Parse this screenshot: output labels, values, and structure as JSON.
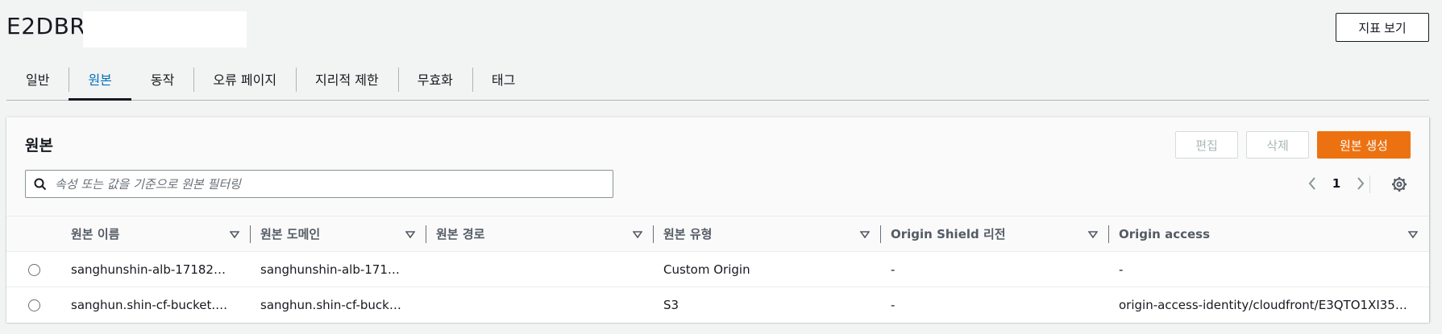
{
  "header": {
    "title": "E2DBR",
    "metrics_button": "지표 보기"
  },
  "tabs": [
    {
      "label": "일반",
      "active": false
    },
    {
      "label": "원본",
      "active": true
    },
    {
      "label": "동작",
      "active": false
    },
    {
      "label": "오류 페이지",
      "active": false
    },
    {
      "label": "지리적 제한",
      "active": false
    },
    {
      "label": "무효화",
      "active": false
    },
    {
      "label": "태그",
      "active": false
    }
  ],
  "panel": {
    "title": "원본",
    "edit_button": "편집",
    "delete_button": "삭제",
    "create_button": "원본 생성",
    "search_placeholder": "속성 또는 값을 기준으로 원본 필터링",
    "page_number": "1"
  },
  "table": {
    "columns": [
      "원본 이름",
      "원본 도메인",
      "원본 경로",
      "원본 유형",
      "Origin Shield 리전",
      "Origin access"
    ],
    "rows": [
      {
        "name": "sanghunshin-alb-17182…",
        "domain": "sanghunshin-alb-171…",
        "path": "",
        "type": "Custom Origin",
        "shield": "-",
        "access": "-"
      },
      {
        "name": "sanghun.shin-cf-bucket.…",
        "domain": "sanghun.shin-cf-buck…",
        "path": "",
        "type": "S3",
        "shield": "-",
        "access": "origin-access-identity/cloudfront/E3QTO1XI35…"
      }
    ]
  },
  "colors": {
    "primary_button": "#ec7211",
    "active_tab_text": "#0073bb",
    "border": "#aab7b8"
  },
  "icons": [
    "search-icon",
    "chevron-left-icon",
    "chevron-right-icon",
    "settings-gear-icon",
    "sort-down-icon"
  ]
}
